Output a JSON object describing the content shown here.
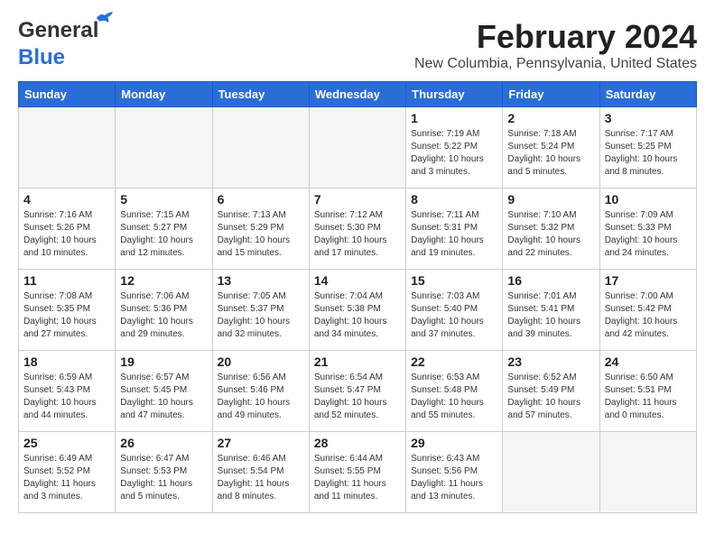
{
  "header": {
    "logo_general": "General",
    "logo_blue": "Blue",
    "month_title": "February 2024",
    "location": "New Columbia, Pennsylvania, United States"
  },
  "weekdays": [
    "Sunday",
    "Monday",
    "Tuesday",
    "Wednesday",
    "Thursday",
    "Friday",
    "Saturday"
  ],
  "weeks": [
    [
      {
        "day": "",
        "sunrise": "",
        "sunset": "",
        "daylight": "",
        "empty": true
      },
      {
        "day": "",
        "sunrise": "",
        "sunset": "",
        "daylight": "",
        "empty": true
      },
      {
        "day": "",
        "sunrise": "",
        "sunset": "",
        "daylight": "",
        "empty": true
      },
      {
        "day": "",
        "sunrise": "",
        "sunset": "",
        "daylight": "",
        "empty": true
      },
      {
        "day": "1",
        "sunrise": "7:19 AM",
        "sunset": "5:22 PM",
        "daylight": "10 hours and 3 minutes."
      },
      {
        "day": "2",
        "sunrise": "7:18 AM",
        "sunset": "5:24 PM",
        "daylight": "10 hours and 5 minutes."
      },
      {
        "day": "3",
        "sunrise": "7:17 AM",
        "sunset": "5:25 PM",
        "daylight": "10 hours and 8 minutes."
      }
    ],
    [
      {
        "day": "4",
        "sunrise": "7:16 AM",
        "sunset": "5:26 PM",
        "daylight": "10 hours and 10 minutes."
      },
      {
        "day": "5",
        "sunrise": "7:15 AM",
        "sunset": "5:27 PM",
        "daylight": "10 hours and 12 minutes."
      },
      {
        "day": "6",
        "sunrise": "7:13 AM",
        "sunset": "5:29 PM",
        "daylight": "10 hours and 15 minutes."
      },
      {
        "day": "7",
        "sunrise": "7:12 AM",
        "sunset": "5:30 PM",
        "daylight": "10 hours and 17 minutes."
      },
      {
        "day": "8",
        "sunrise": "7:11 AM",
        "sunset": "5:31 PM",
        "daylight": "10 hours and 19 minutes."
      },
      {
        "day": "9",
        "sunrise": "7:10 AM",
        "sunset": "5:32 PM",
        "daylight": "10 hours and 22 minutes."
      },
      {
        "day": "10",
        "sunrise": "7:09 AM",
        "sunset": "5:33 PM",
        "daylight": "10 hours and 24 minutes."
      }
    ],
    [
      {
        "day": "11",
        "sunrise": "7:08 AM",
        "sunset": "5:35 PM",
        "daylight": "10 hours and 27 minutes."
      },
      {
        "day": "12",
        "sunrise": "7:06 AM",
        "sunset": "5:36 PM",
        "daylight": "10 hours and 29 minutes."
      },
      {
        "day": "13",
        "sunrise": "7:05 AM",
        "sunset": "5:37 PM",
        "daylight": "10 hours and 32 minutes."
      },
      {
        "day": "14",
        "sunrise": "7:04 AM",
        "sunset": "5:38 PM",
        "daylight": "10 hours and 34 minutes."
      },
      {
        "day": "15",
        "sunrise": "7:03 AM",
        "sunset": "5:40 PM",
        "daylight": "10 hours and 37 minutes."
      },
      {
        "day": "16",
        "sunrise": "7:01 AM",
        "sunset": "5:41 PM",
        "daylight": "10 hours and 39 minutes."
      },
      {
        "day": "17",
        "sunrise": "7:00 AM",
        "sunset": "5:42 PM",
        "daylight": "10 hours and 42 minutes."
      }
    ],
    [
      {
        "day": "18",
        "sunrise": "6:59 AM",
        "sunset": "5:43 PM",
        "daylight": "10 hours and 44 minutes."
      },
      {
        "day": "19",
        "sunrise": "6:57 AM",
        "sunset": "5:45 PM",
        "daylight": "10 hours and 47 minutes."
      },
      {
        "day": "20",
        "sunrise": "6:56 AM",
        "sunset": "5:46 PM",
        "daylight": "10 hours and 49 minutes."
      },
      {
        "day": "21",
        "sunrise": "6:54 AM",
        "sunset": "5:47 PM",
        "daylight": "10 hours and 52 minutes."
      },
      {
        "day": "22",
        "sunrise": "6:53 AM",
        "sunset": "5:48 PM",
        "daylight": "10 hours and 55 minutes."
      },
      {
        "day": "23",
        "sunrise": "6:52 AM",
        "sunset": "5:49 PM",
        "daylight": "10 hours and 57 minutes."
      },
      {
        "day": "24",
        "sunrise": "6:50 AM",
        "sunset": "5:51 PM",
        "daylight": "11 hours and 0 minutes."
      }
    ],
    [
      {
        "day": "25",
        "sunrise": "6:49 AM",
        "sunset": "5:52 PM",
        "daylight": "11 hours and 3 minutes."
      },
      {
        "day": "26",
        "sunrise": "6:47 AM",
        "sunset": "5:53 PM",
        "daylight": "11 hours and 5 minutes."
      },
      {
        "day": "27",
        "sunrise": "6:46 AM",
        "sunset": "5:54 PM",
        "daylight": "11 hours and 8 minutes."
      },
      {
        "day": "28",
        "sunrise": "6:44 AM",
        "sunset": "5:55 PM",
        "daylight": "11 hours and 11 minutes."
      },
      {
        "day": "29",
        "sunrise": "6:43 AM",
        "sunset": "5:56 PM",
        "daylight": "11 hours and 13 minutes."
      },
      {
        "day": "",
        "sunrise": "",
        "sunset": "",
        "daylight": "",
        "empty": true
      },
      {
        "day": "",
        "sunrise": "",
        "sunset": "",
        "daylight": "",
        "empty": true
      }
    ]
  ]
}
